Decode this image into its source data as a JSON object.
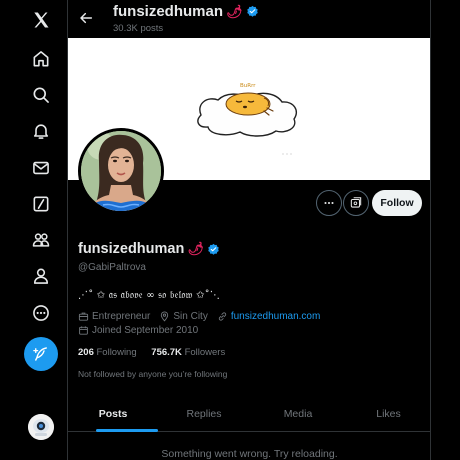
{
  "nav": {
    "items": [
      {
        "name": "x-logo-icon"
      },
      {
        "name": "home-icon"
      },
      {
        "name": "search-icon"
      },
      {
        "name": "notifications-icon"
      },
      {
        "name": "messages-icon"
      },
      {
        "name": "grok-icon"
      },
      {
        "name": "communities-icon"
      },
      {
        "name": "profile-icon"
      },
      {
        "name": "more-icon"
      }
    ],
    "post_button_icon": "feather-plus-icon",
    "accent": "#1d9bf0"
  },
  "header": {
    "title": "funsizedhuman",
    "emoji": "🌶",
    "posts_count": "30.3K posts"
  },
  "banner": {
    "description_text": "BuRrr"
  },
  "profile": {
    "display_name": "funsizedhuman",
    "emoji": "🌶",
    "handle": "@GabiPaltrova",
    "bio": "⋰˚ ✩ 𝔞𝔰 𝔞𝔟𝔬𝔳𝔢 ∞ 𝔰𝔬 𝔟𝔢𝔩𝔬𝔴 ✩˚⋱",
    "category": "Entrepreneur",
    "location": "Sin City",
    "website": "funsizedhuman.com",
    "joined": "Joined September 2010",
    "following_count": "206",
    "following_label": "Following",
    "followers_count": "756.7K",
    "followers_label": "Followers",
    "not_followed_text": "Not followed by anyone you’re following"
  },
  "actions": {
    "follow_label": "Follow"
  },
  "tabs": [
    {
      "label": "Posts",
      "active": true
    },
    {
      "label": "Replies",
      "active": false
    },
    {
      "label": "Media",
      "active": false
    },
    {
      "label": "Likes",
      "active": false
    }
  ],
  "error_text": "Something went wrong. Try reloading."
}
